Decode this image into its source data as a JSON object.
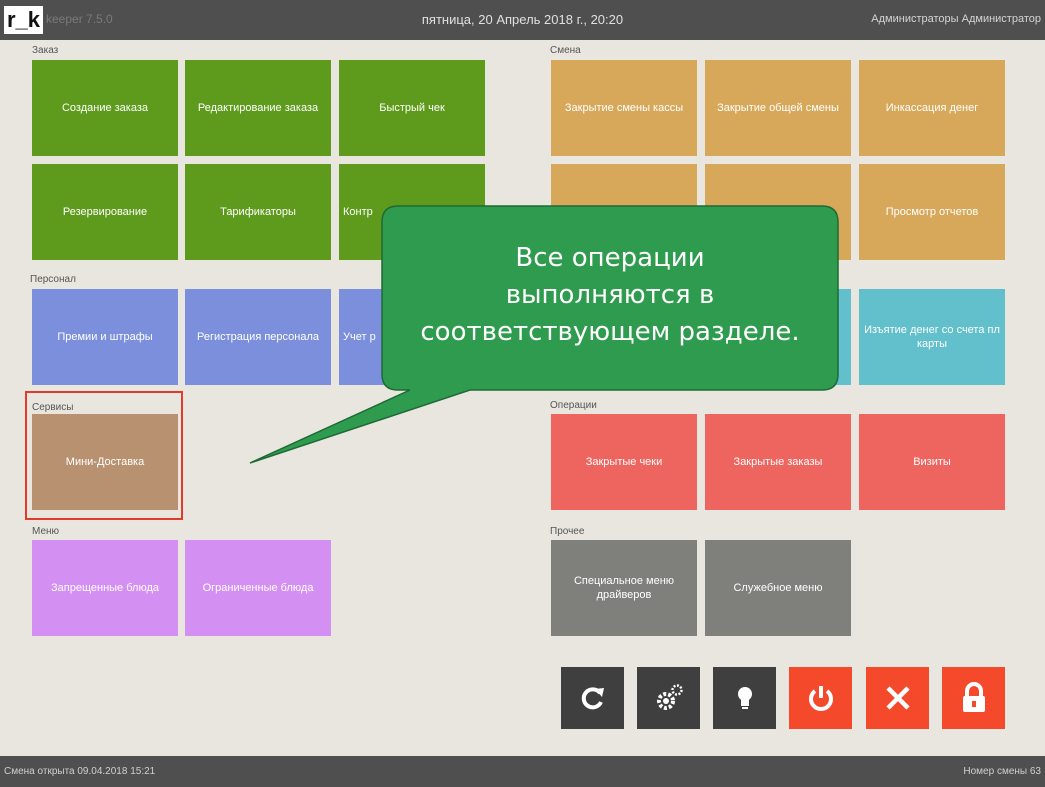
{
  "header": {
    "logo": "r_k",
    "logo_sub": "keeper 7.5.0",
    "datetime": "пятница, 20 Апрель 2018 г., 20:20",
    "user": "Администраторы Администратор"
  },
  "sections": {
    "zakaz": "Заказ",
    "smena": "Смена",
    "personal": "Персонал",
    "servisy": "Сервисы",
    "operacii": "Операции",
    "menu": "Меню",
    "prochee": "Прочее"
  },
  "tiles": {
    "sozdanie": "Создание заказа",
    "redaktirovanie": "Редактирование заказа",
    "bystryi_chek": "Быстрый чек",
    "rezervirovanie": "Резервирование",
    "tarifikatory": "Тарификаторы",
    "kontr": "Контр",
    "zakrytie_kassy": "Закрытие смены кассы",
    "zakrytie_obshei": "Закрытие общей смены",
    "inkassaciya": "Инкассация денег",
    "prosmotr_otchetov": "Просмотр отчетов",
    "premii": "Премии и штрафы",
    "registraciya": "Регистрация персонала",
    "uchet": "Учет р",
    "iz_atie": "Изъятие денег со счета пл карты",
    "mini_dostavka": "Мини-Доставка",
    "zakrytye_cheki": "Закрытые чеки",
    "zakrytye_zakazy": "Закрытые заказы",
    "vizity": "Визиты",
    "zapreshennye": "Запрещенные блюда",
    "ogranichennye": "Ограниченные блюда",
    "specialnoe_menu": "Специальное меню драйверов",
    "sluzhebnoe_menu": "Служебное меню"
  },
  "callout": {
    "text_line1": "Все операции",
    "text_line2": "выполняются в",
    "text_line3": "соответствующем разделе."
  },
  "toolbar": {
    "icons": [
      "refresh-icon",
      "gears-icon",
      "bulb-icon",
      "power-icon",
      "close-icon",
      "lock-icon"
    ]
  },
  "footer": {
    "status_left": "Смена открыта 09.04.2018 15:21",
    "status_right": "Номер смены 63"
  },
  "colors": {
    "green": "#5e9b1c",
    "orange": "#d7a85a",
    "blue": "#7b8fdc",
    "teal": "#62bfcc",
    "brown": "#b89270",
    "red": "#ee6560",
    "pink": "#d48ff2",
    "grey": "#7f7f7b",
    "danger": "#f44a2b",
    "callout": "#2e9b4e"
  }
}
